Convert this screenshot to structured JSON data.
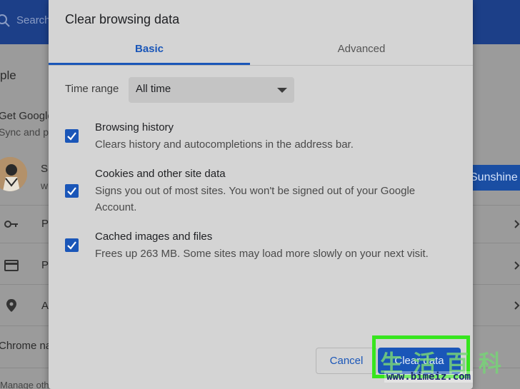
{
  "background": {
    "search_placeholder": "Search",
    "people_title": "ple",
    "get_google": "Get Google",
    "sync_text": "Sync and p",
    "profile_letter": "S",
    "profile_letter2": "w",
    "row_letters": [
      "P",
      "P",
      "A"
    ],
    "sunshine_label": "Sunshine",
    "chrome_name": "Chrome na",
    "manage_text": "Manage oth"
  },
  "dialog": {
    "title": "Clear browsing data",
    "tabs": [
      {
        "label": "Basic",
        "active": true
      },
      {
        "label": "Advanced",
        "active": false
      }
    ],
    "time_range": {
      "label": "Time range",
      "value": "All time"
    },
    "options": [
      {
        "title": "Browsing history",
        "description": "Clears history and autocompletions in the address bar.",
        "checked": true
      },
      {
        "title": "Cookies and other site data",
        "description": "Signs you out of most sites. You won't be signed out of your Google Account.",
        "checked": true
      },
      {
        "title": "Cached images and files",
        "description": "Frees up 263 MB. Some sites may load more slowly on your next visit.",
        "checked": true
      }
    ],
    "buttons": {
      "cancel": "Cancel",
      "clear": "Clear data"
    }
  },
  "watermark": {
    "cjk": "生活百科",
    "url": "www.bimeiz.com"
  },
  "colors": {
    "accent": "#1a56b8",
    "highlight": "#37e51e",
    "topbar": "#1c3f88"
  }
}
